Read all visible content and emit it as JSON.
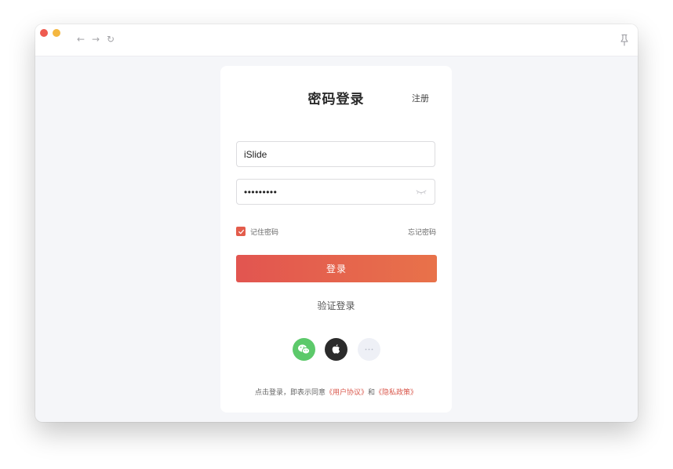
{
  "window": {
    "nav": {
      "back": "←",
      "forward": "→",
      "reload": "↻"
    }
  },
  "login": {
    "title": "密码登录",
    "register": "注册",
    "username_value": "iSlide",
    "password_value": "•••••••••",
    "remember_label": "记住密码",
    "remember_checked": true,
    "forgot": "忘记密码",
    "login_button": "登录",
    "alt_login": "验证登录",
    "social": [
      {
        "icon": "wechat-icon"
      },
      {
        "icon": "apple-icon"
      },
      {
        "icon": "more-icon"
      }
    ],
    "agreement": {
      "prefix": "点击登录，即表示同意",
      "user_agreement": "《用户协议》",
      "and": "和",
      "privacy_policy": "《隐私政策》"
    }
  },
  "colors": {
    "accent": "#e35c4b",
    "gradient_start": "#e25550",
    "gradient_end": "#e8724a",
    "wechat": "#5cc96a",
    "apple": "#2b2b2b"
  }
}
